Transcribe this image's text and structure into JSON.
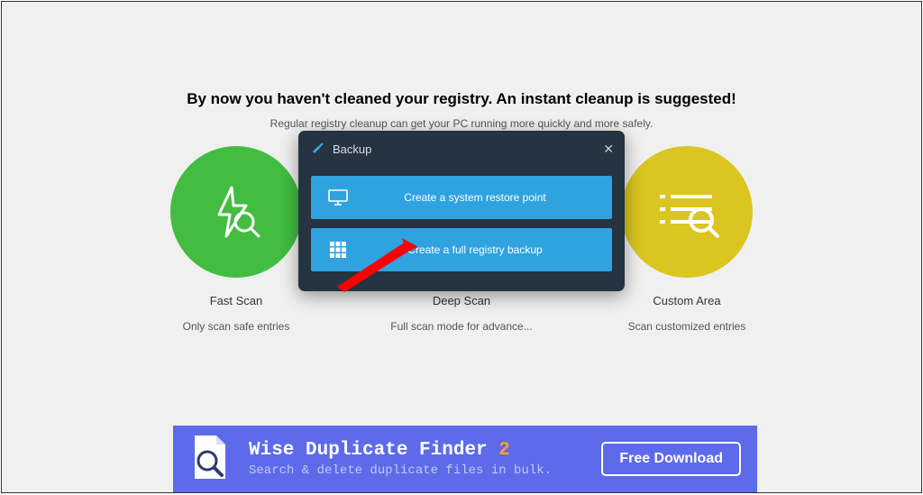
{
  "page": {
    "headline": "By now you haven't cleaned your registry. An instant cleanup is suggested!",
    "subtext": "Regular registry cleanup can get your PC running more quickly and more safely."
  },
  "options": [
    {
      "title": "Fast Scan",
      "desc": "Only scan safe entries"
    },
    {
      "title": "Deep Scan",
      "desc": "Full scan mode for advance..."
    },
    {
      "title": "Custom Area",
      "desc": "Scan customized entries"
    }
  ],
  "modal": {
    "title": "Backup",
    "option_restore": "Create a system restore point",
    "option_backup": "Create a full registry backup"
  },
  "banner": {
    "product_prefix": "Wise Duplicate Finder ",
    "product_suffix": "2",
    "tagline": "Search & delete duplicate files in bulk.",
    "cta": "Free Download"
  }
}
